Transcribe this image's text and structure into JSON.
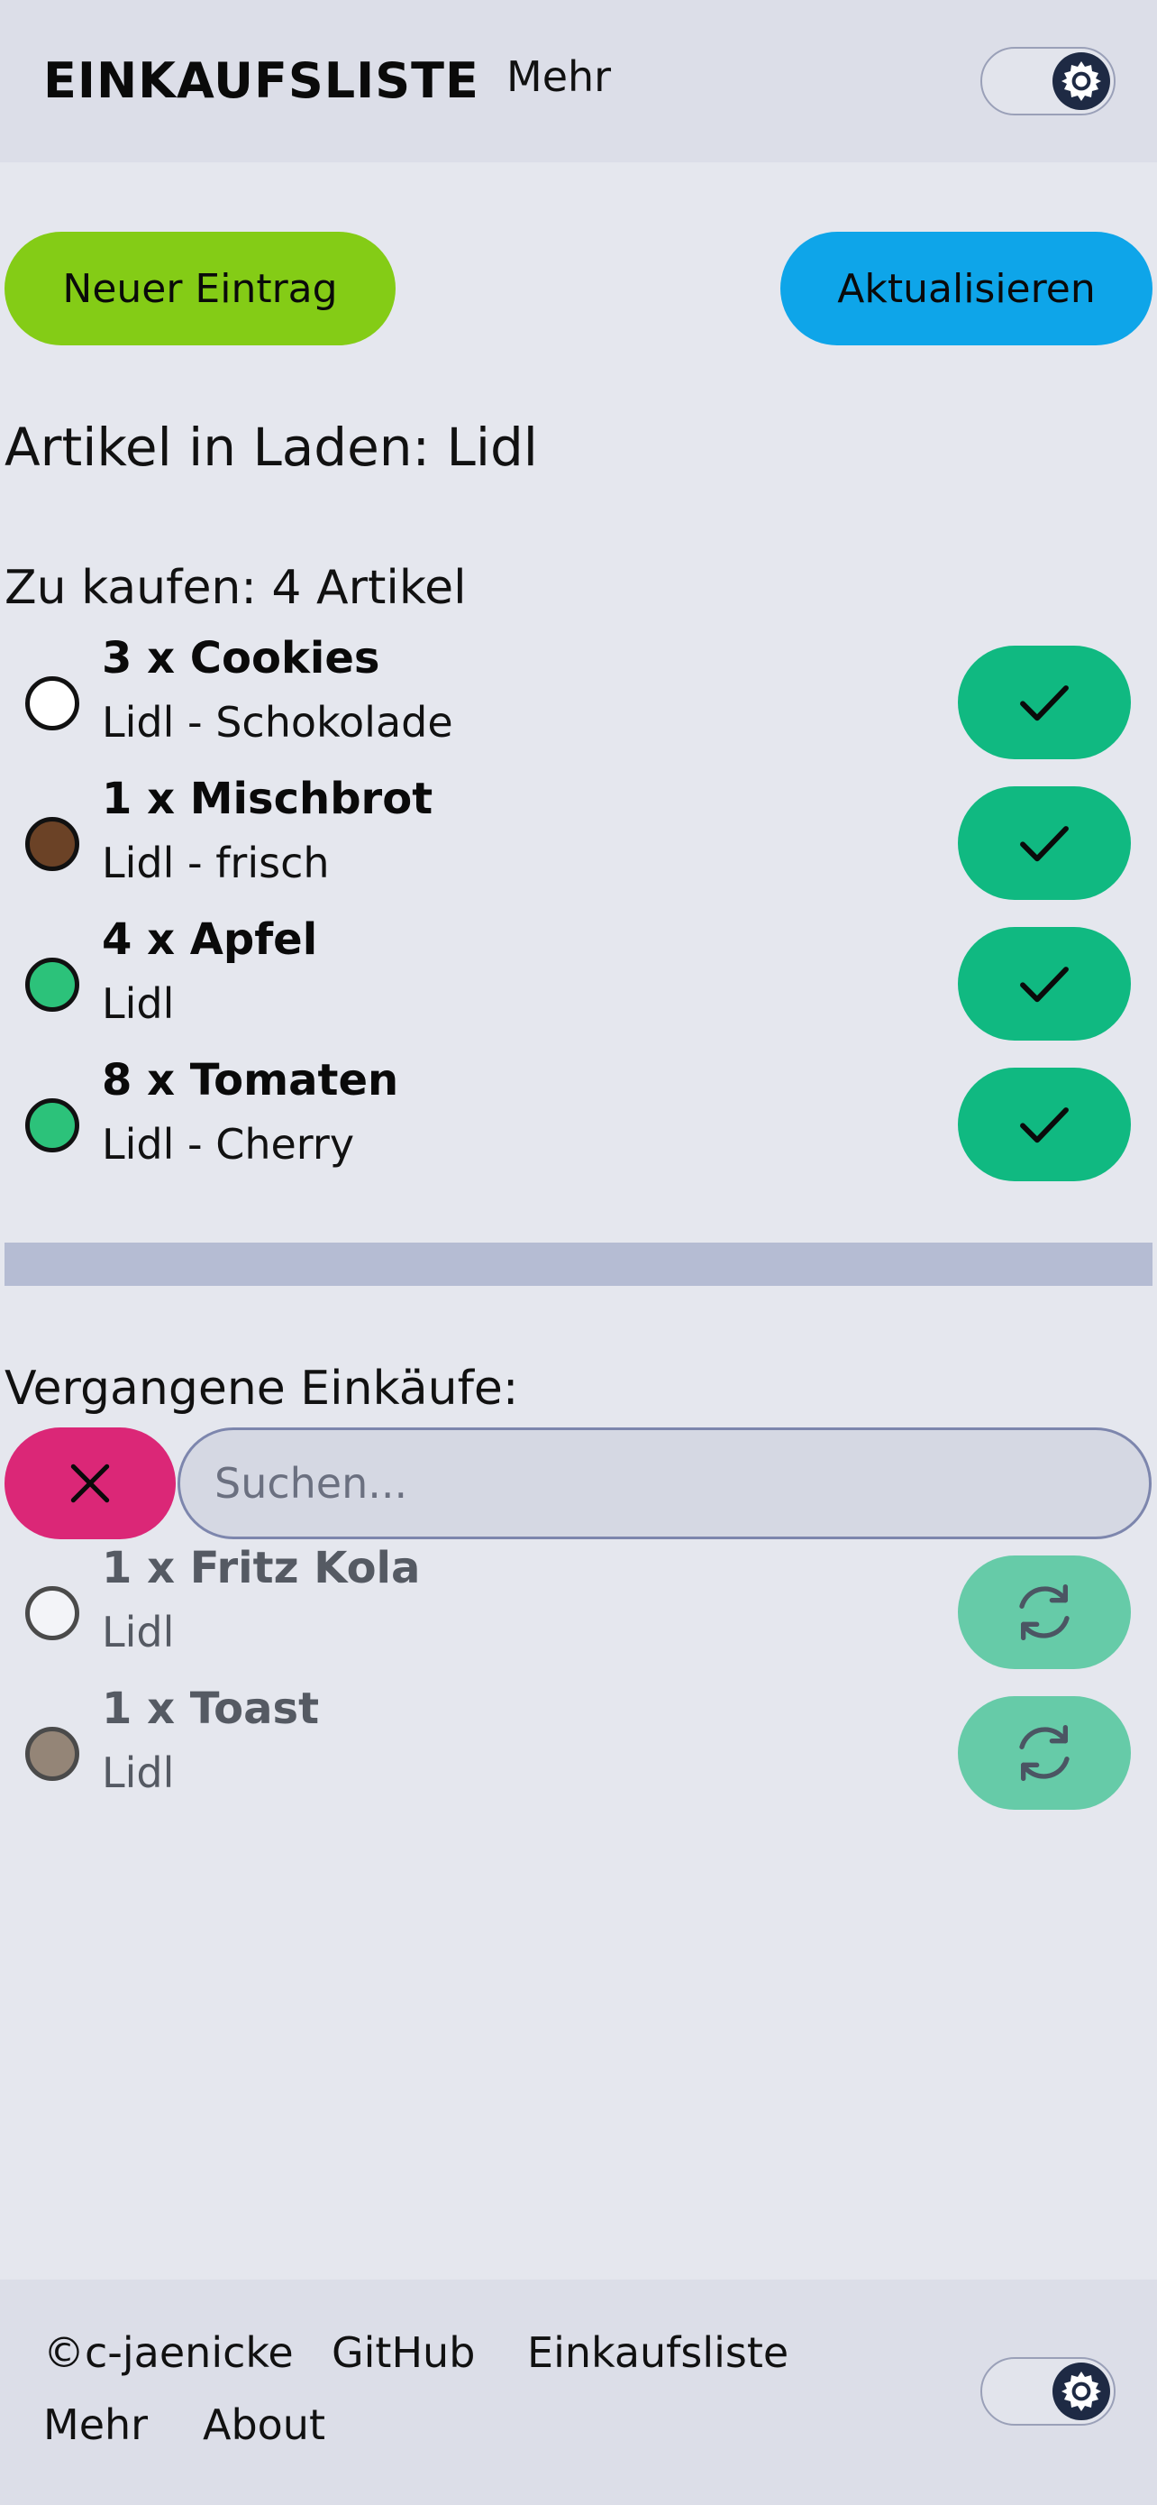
{
  "header": {
    "brand": "EINKAUFSLISTE",
    "link_more": "Mehr",
    "theme_toggle_icon": "gear-icon"
  },
  "actions": {
    "new_entry_label": "Neuer Eintrag",
    "refresh_label": "Aktualisieren"
  },
  "store": {
    "title": "Artikel in Laden: Lidl"
  },
  "to_buy": {
    "heading": "Zu kaufen: 4 Artikel",
    "items": [
      {
        "title": "3 x Cookies",
        "subtitle": "Lidl - Schokolade",
        "color": "#ffffff"
      },
      {
        "title": "1 x Mischbrot",
        "subtitle": "Lidl - frisch",
        "color": "#6b4226"
      },
      {
        "title": "4 x Apfel",
        "subtitle": "Lidl",
        "color": "#2cc27a"
      },
      {
        "title": "8 x Tomaten",
        "subtitle": "Lidl - Cherry",
        "color": "#2cc27a"
      }
    ]
  },
  "past": {
    "heading": "Vergangene Einkäufe:",
    "search_placeholder": "Suchen...",
    "items": [
      {
        "title": "1 x Fritz Kola",
        "subtitle": "Lidl",
        "color": "#f3f4f8"
      },
      {
        "title": "1 x Toast",
        "subtitle": "Lidl",
        "color": "#948577"
      }
    ]
  },
  "footer": {
    "copyright": "©c-jaenicke",
    "github": "GitHub",
    "app_link": "Einkaufsliste",
    "more": "Mehr",
    "about": "About"
  },
  "colors": {
    "accent_green": "#84cc16",
    "accent_blue": "#0ea5e9",
    "check_green": "#10b981",
    "clear_pink": "#db2777",
    "redo_green": "#66cba8"
  }
}
